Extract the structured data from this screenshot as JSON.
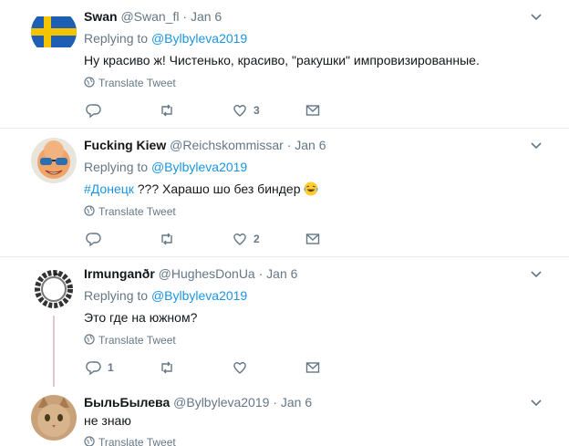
{
  "tweets": [
    {
      "name": "Swan",
      "handle": "@Swan_fl",
      "dot": "·",
      "date": "Jan 6",
      "replying_prefix": "Replying to",
      "replying_to": "@Bylbyleva2019",
      "text": "Ну красиво ж! Чистенько, красиво, \"ракушки\" импровизированные.",
      "translate": "Translate Tweet",
      "counts": {
        "reply": "",
        "retweet": "",
        "like": "3"
      }
    },
    {
      "name": "Fucking Kiew",
      "handle": "@Reichskommissar",
      "dot": "·",
      "date": "Jan 6",
      "replying_prefix": "Replying to",
      "replying_to": "@Bylbyleva2019",
      "hashtag": "#Донецк",
      "text": " ??? Харашо шо без биндер ",
      "translate": "Translate Tweet",
      "counts": {
        "reply": "",
        "retweet": "",
        "like": "2"
      }
    },
    {
      "name": "Irmunganðr",
      "handle": "@HughesDonUa",
      "dot": "·",
      "date": "Jan 6",
      "replying_prefix": "Replying to",
      "replying_to": "@Bylbyleva2019",
      "text": "Это где на южном?",
      "translate": "Translate Tweet",
      "counts": {
        "reply": "1",
        "retweet": "",
        "like": ""
      }
    },
    {
      "name": "БыльБылева",
      "handle": "@Bylbyleva2019",
      "dot": "·",
      "date": "Jan 6",
      "text": "не знаю",
      "translate": "Translate Tweet"
    }
  ],
  "icons": {
    "caret": "chevron-down-icon",
    "globe": "globe-icon",
    "reply": "reply-icon",
    "retweet": "retweet-icon",
    "like": "heart-icon",
    "dm": "envelope-icon",
    "emoji": "laughing-emoji-icon"
  },
  "colors": {
    "link": "#1b95e0",
    "muted": "#657786",
    "text": "#14171a",
    "divider": "#e6ecf0"
  }
}
